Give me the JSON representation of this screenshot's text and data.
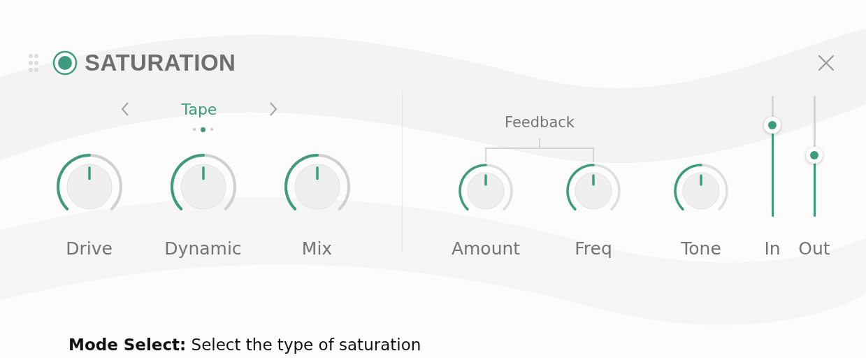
{
  "header": {
    "power_on": true,
    "title": "SATURATION"
  },
  "mode": {
    "label": "Tape",
    "dots": [
      {
        "selected": false
      },
      {
        "selected": true
      },
      {
        "selected": false
      }
    ]
  },
  "knobs": [
    {
      "label": "Drive"
    },
    {
      "label": "Dynamic"
    },
    {
      "label": "Mix"
    }
  ],
  "feedback": {
    "label": "Feedback",
    "knobs": [
      {
        "label": "Amount"
      },
      {
        "label": "Freq"
      }
    ]
  },
  "tone": {
    "label": "Tone"
  },
  "faders": [
    {
      "label": "In",
      "level": 0.76
    },
    {
      "label": "Out",
      "level": 0.51
    }
  ],
  "caption": "**Mode Select:** Select the type of saturation"
}
